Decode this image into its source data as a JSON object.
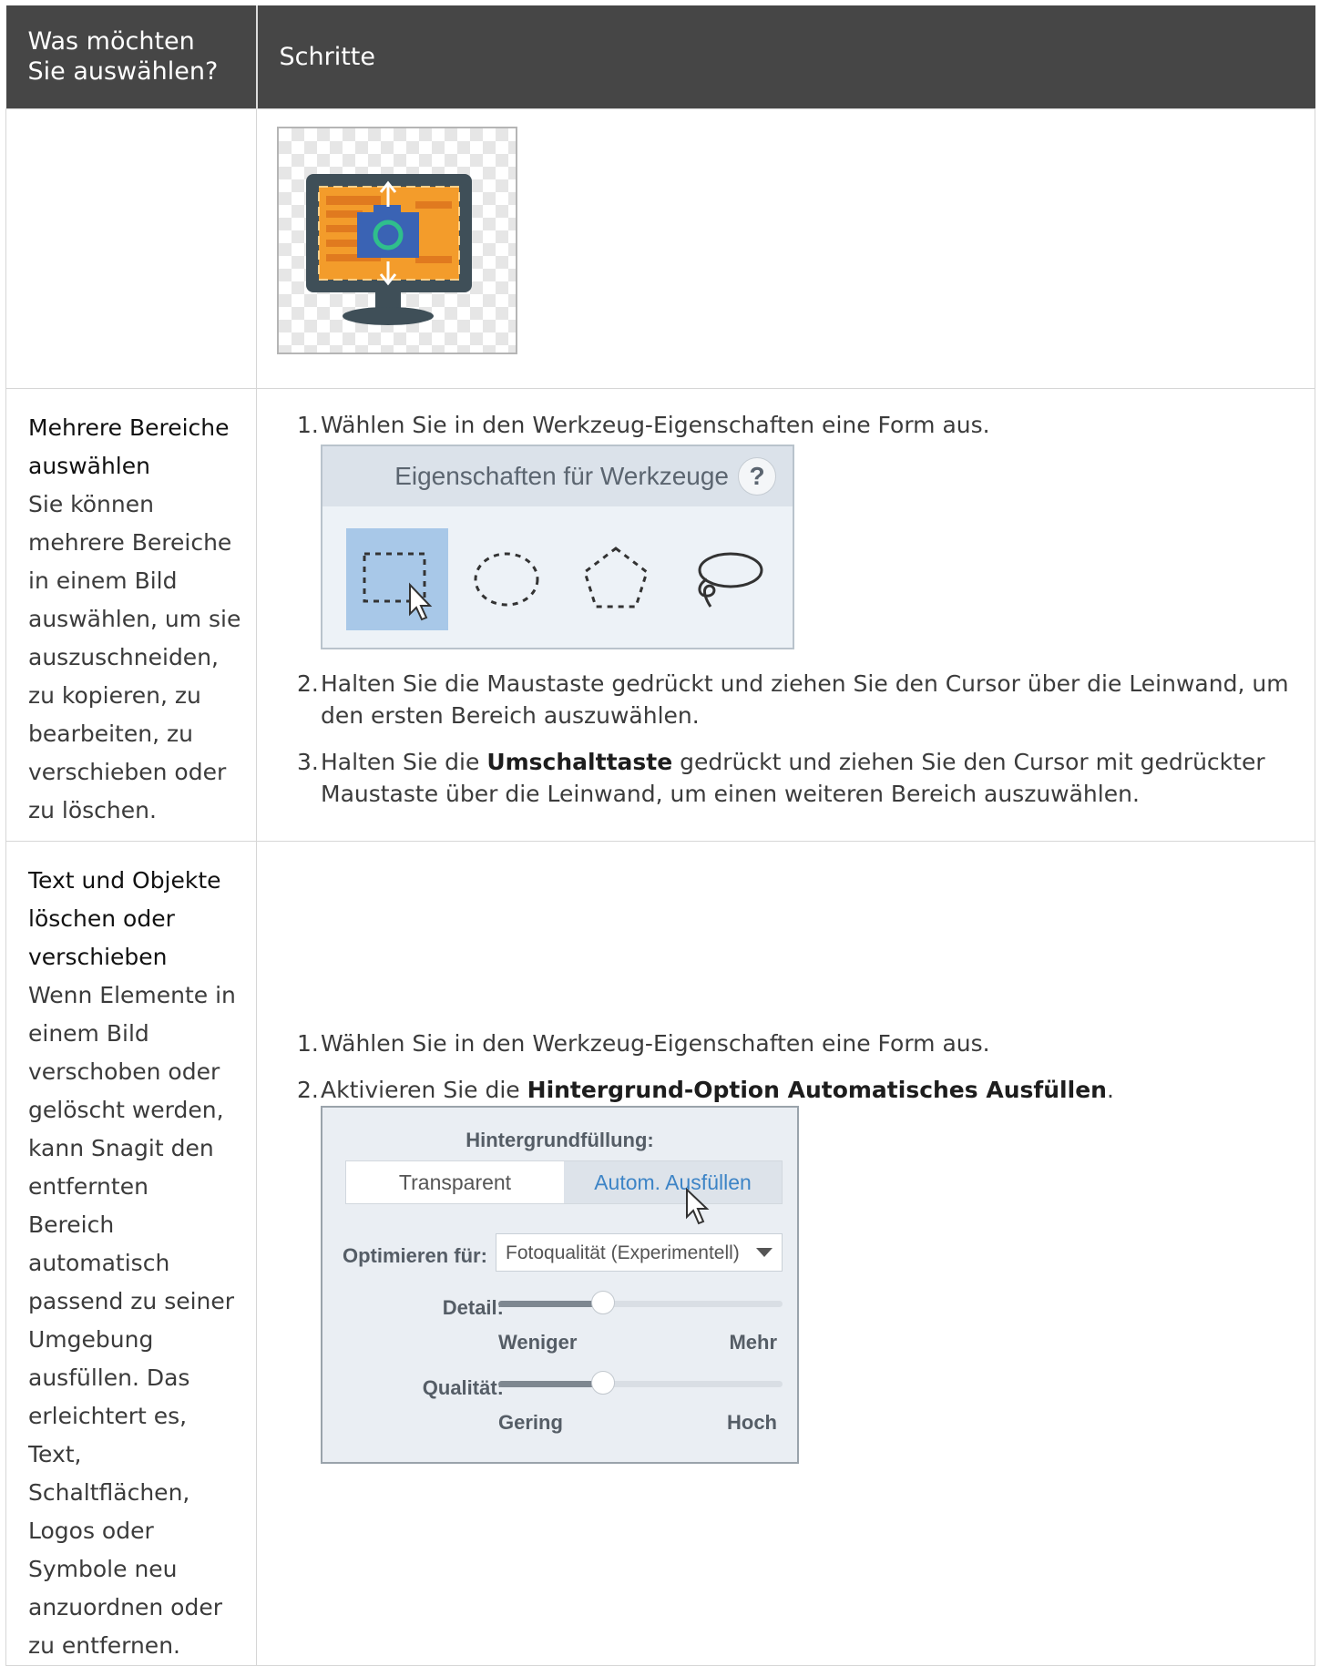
{
  "header": {
    "col1": "Was möchten Sie auswählen?",
    "col2": "Schritte"
  },
  "rows": [
    {
      "image": {
        "icon": "monitor-camera-resize-icon"
      }
    },
    {
      "title": "Mehrere Bereiche auswählen",
      "description": "Sie können mehrere Bereiche in einem Bild auswählen, um sie auszuschneiden, zu kopieren, zu bearbeiten, zu verschieben oder zu löschen.",
      "steps": [
        {
          "num": "1.",
          "text": "Wählen Sie in den Werkzeug-Eigenschaften eine Form aus."
        },
        {
          "num": "2.",
          "text": "Halten Sie die Maustaste gedrückt und ziehen Sie den Cursor über die Leinwand, um den ersten Bereich auszuwählen."
        },
        {
          "num": "3.",
          "pre": "Halten Sie die ",
          "bold": "Umschalttaste",
          "post": " gedrückt und ziehen Sie den Cursor mit gedrückter Maustaste über die Leinwand, um einen weiteren Bereich auszuwählen."
        }
      ],
      "tool_panel": {
        "title": "Eigenschaften für Werkzeuge",
        "help": "?",
        "shapes": [
          "rectangle-select-icon",
          "ellipse-select-icon",
          "polygon-select-icon",
          "lasso-select-icon"
        ],
        "selected": "rectangle-select-icon"
      }
    },
    {
      "title": "Text und Objekte löschen oder verschieben",
      "description": "Wenn Elemente in einem Bild verschoben oder gelöscht werden, kann Snagit den entfernten Bereich automatisch passend zu seiner Umgebung ausfüllen. Das erleichtert es, Text, Schaltflächen, Logos oder Symbole neu anzuordnen oder zu entfernen.",
      "steps": [
        {
          "num": "1.",
          "text": "Wählen Sie in den Werkzeug-Eigenschaften eine Form aus."
        },
        {
          "num": "2.",
          "pre": "Aktivieren Sie die ",
          "bold": "Hintergrund-Option Automatisches Ausfüllen",
          "post": "."
        }
      ],
      "fill_panel": {
        "title": "Hintergrundfüllung:",
        "transparent": "Transparent",
        "auto_fill": "Autom. Ausfüllen",
        "optimize_label": "Optimieren für:",
        "optimize_value": "Fotoqualität (Experimentell)",
        "detail_label": "Detail:",
        "detail_level": 0.37,
        "detail_min": "Weniger",
        "detail_max": "Mehr",
        "quality_label": "Qualität:",
        "quality_level": 0.37,
        "quality_min": "Gering",
        "quality_max": "Hoch"
      }
    }
  ]
}
